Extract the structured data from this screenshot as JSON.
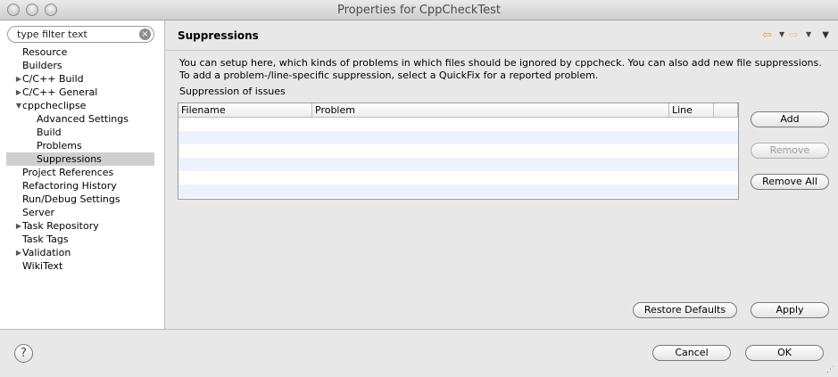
{
  "window": {
    "title": "Properties for CppCheckTest"
  },
  "sidebar": {
    "filter": {
      "value": "type filter text"
    },
    "items": [
      {
        "label": "Resource",
        "indent": 0,
        "arrow": ""
      },
      {
        "label": "Builders",
        "indent": 0,
        "arrow": ""
      },
      {
        "label": "C/C++ Build",
        "indent": 0,
        "arrow": "▶"
      },
      {
        "label": "C/C++ General",
        "indent": 0,
        "arrow": "▶"
      },
      {
        "label": "cppcheclipse",
        "indent": 0,
        "arrow": "▼"
      },
      {
        "label": "Advanced Settings",
        "indent": 1,
        "arrow": ""
      },
      {
        "label": "Build",
        "indent": 1,
        "arrow": ""
      },
      {
        "label": "Problems",
        "indent": 1,
        "arrow": ""
      },
      {
        "label": "Suppressions",
        "indent": 1,
        "arrow": "",
        "selected": true
      },
      {
        "label": "Project References",
        "indent": 0,
        "arrow": ""
      },
      {
        "label": "Refactoring History",
        "indent": 0,
        "arrow": ""
      },
      {
        "label": "Run/Debug Settings",
        "indent": 0,
        "arrow": ""
      },
      {
        "label": "Server",
        "indent": 0,
        "arrow": ""
      },
      {
        "label": "Task Repository",
        "indent": 0,
        "arrow": "▶"
      },
      {
        "label": "Task Tags",
        "indent": 0,
        "arrow": ""
      },
      {
        "label": "Validation",
        "indent": 0,
        "arrow": "▶"
      },
      {
        "label": "WikiText",
        "indent": 0,
        "arrow": ""
      }
    ]
  },
  "main": {
    "title": "Suppressions",
    "description": "You can setup here, which kinds of problems in which files should be ignored by cppcheck. You can also add new file suppressions. To add a problem-/line-specific suppression, select a QuickFix for a reported problem.",
    "section_label": "Suppression of issues",
    "table": {
      "columns": [
        "Filename",
        "Problem",
        "Line"
      ],
      "rows": []
    },
    "buttons": {
      "add": "Add",
      "remove": "Remove",
      "remove_all": "Remove All",
      "restore_defaults": "Restore Defaults",
      "apply": "Apply"
    }
  },
  "footer": {
    "help": "?",
    "cancel": "Cancel",
    "ok": "OK"
  },
  "icons": {
    "back": "back-arrow-icon",
    "forward": "forward-arrow-icon",
    "menu": "view-menu-icon",
    "clear": "clear-search-icon",
    "help": "help-icon"
  },
  "colors": {
    "nav_arrow": "#e2a01a",
    "selection": "#cfcfcf",
    "table_alt_row": "#edf3fe"
  }
}
